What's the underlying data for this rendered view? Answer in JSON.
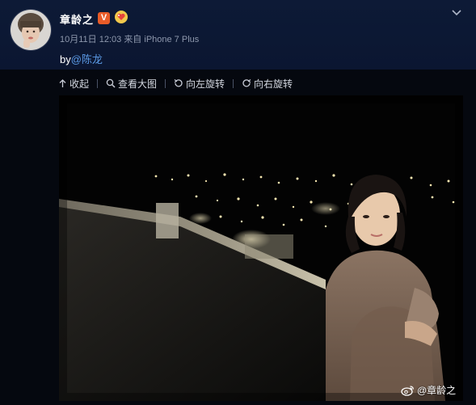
{
  "post": {
    "username": "章龄之",
    "verified_badge": "V",
    "timestamp": "10月11日 12:03",
    "source_prefix": "来自",
    "source_device": "iPhone 7 Plus",
    "text_prefix": "by",
    "mention": "@陈龙"
  },
  "toolbar": {
    "collapse_label": "收起",
    "view_large_label": "查看大图",
    "rotate_left_label": "向左旋转",
    "rotate_right_label": "向右旋转"
  },
  "photo": {
    "watermark_text": "@章龄之"
  },
  "icons": {
    "verified": "verified-v-icon",
    "member": "member-heart-icon",
    "menu": "chevron-down-icon",
    "collapse": "collapse-up-icon",
    "view_large": "magnifier-icon",
    "rotate_left": "rotate-left-icon",
    "rotate_right": "rotate-right-icon",
    "weibo": "weibo-logo-icon"
  },
  "colors": {
    "background": "#0c1730",
    "mention": "#5b9ae6",
    "verified_badge": "#e85b28",
    "meta_text": "#8e98ad"
  }
}
